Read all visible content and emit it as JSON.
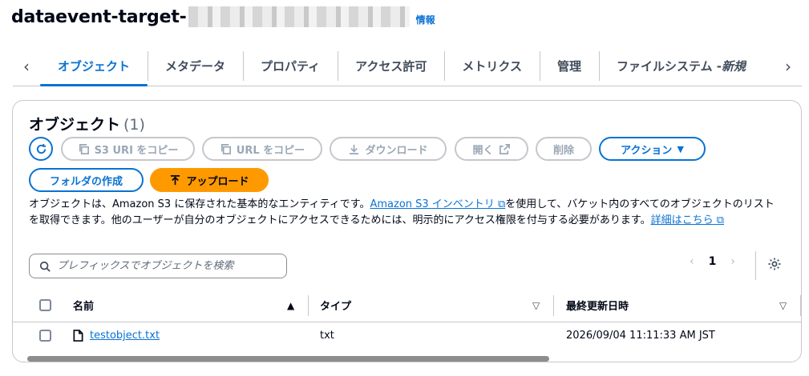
{
  "header": {
    "bucket_name_prefix": "dataevent-target-",
    "info_link": "情報"
  },
  "tabs": [
    {
      "label": "オブジェクト"
    },
    {
      "label": "メタデータ"
    },
    {
      "label": "プロパティ"
    },
    {
      "label": "アクセス許可"
    },
    {
      "label": "メトリクス"
    },
    {
      "label": "管理"
    },
    {
      "label": "ファイルシステム - ",
      "italic": "新規"
    }
  ],
  "objects_panel": {
    "title": "オブジェクト",
    "count": "(1)",
    "buttons": {
      "copy_s3_uri": "S3 URI をコピー",
      "copy_url": "URL をコピー",
      "download": "ダウンロード",
      "open": "開く",
      "delete": "削除",
      "actions": "アクション",
      "create_folder": "フォルダの作成",
      "upload": "アップロード"
    },
    "description": {
      "text1": "オブジェクトは、Amazon S3 に保存された基本的なエンティティです。",
      "link1": "Amazon S3 インベントリ",
      "text2": "を使用して、バケット内のすべてのオブジェクトのリストを取得できます。他のユーザーが自分のオブジェクトにアクセスできるためには、明示的にアクセス権限を付与する必要があります。",
      "link2": "詳細はこちら"
    },
    "search": {
      "placeholder": "プレフィックスでオブジェクトを検索"
    },
    "pagination": {
      "current_page": "1"
    },
    "table": {
      "columns": {
        "name": "名前",
        "type": "タイプ",
        "last_modified": "最終更新日時"
      },
      "rows": [
        {
          "name": "testobject.txt",
          "type": "txt",
          "last_modified": "2026/09/04 11:11:33 AM JST"
        }
      ]
    }
  },
  "colors": {
    "accent": "#0972d3",
    "upload": "#ff9900",
    "border": "#c6c6cd"
  }
}
